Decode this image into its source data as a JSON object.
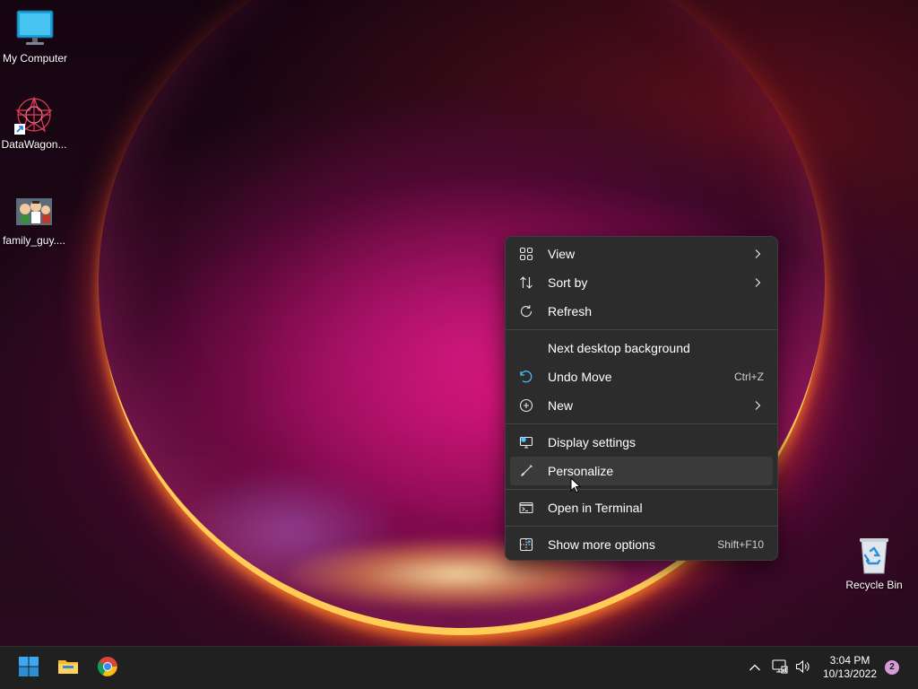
{
  "desktop": {
    "icons": [
      {
        "label": "My Computer",
        "icon": "monitor-icon"
      },
      {
        "label": "DataWagon...",
        "icon": "datawagon-shortcut-icon"
      },
      {
        "label": "family_guy....",
        "icon": "image-file-icon"
      },
      {
        "label": "Recycle Bin",
        "icon": "recycle-bin-icon"
      }
    ]
  },
  "context_menu": {
    "items": [
      {
        "label": "View",
        "icon": "grid-view-icon",
        "submenu": true
      },
      {
        "label": "Sort by",
        "icon": "sort-arrows-icon",
        "submenu": true
      },
      {
        "label": "Refresh",
        "icon": "refresh-icon"
      },
      {
        "label": "Next desktop background"
      },
      {
        "label": "Undo Move",
        "icon": "undo-icon",
        "shortcut": "Ctrl+Z"
      },
      {
        "label": "New",
        "icon": "plus-circle-icon",
        "submenu": true
      },
      {
        "label": "Display settings",
        "icon": "display-settings-icon"
      },
      {
        "label": "Personalize",
        "icon": "brush-icon",
        "hovered": true
      },
      {
        "label": "Open in Terminal",
        "icon": "terminal-icon"
      },
      {
        "label": "Show more options",
        "icon": "more-options-icon",
        "shortcut": "Shift+F10"
      }
    ]
  },
  "taskbar": {
    "apps": [
      {
        "name": "Start",
        "icon": "windows-start-icon"
      },
      {
        "name": "File Explorer",
        "icon": "folder-icon"
      },
      {
        "name": "Google Chrome",
        "icon": "chrome-icon"
      }
    ],
    "tray": [
      "chevron-up-icon",
      "network-icon",
      "volume-icon"
    ],
    "clock": {
      "time": "3:04 PM",
      "date": "10/13/2022"
    },
    "notification_count": "2"
  },
  "colors": {
    "menu_bg": "#2c2c2c",
    "menu_hover": "#3a3a3a",
    "taskbar_bg": "#202020",
    "accent": "#4cc2ff",
    "notif_badge": "#d59bd7"
  }
}
